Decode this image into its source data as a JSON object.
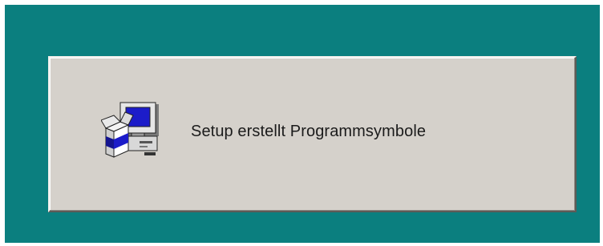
{
  "dialog": {
    "message": "Setup erstellt Programmsymbole",
    "icon": "setup-computer-icon"
  },
  "colors": {
    "desktop": "#0b7f7f",
    "panel": "#d5d1cb",
    "text": "#1b1b1b"
  }
}
